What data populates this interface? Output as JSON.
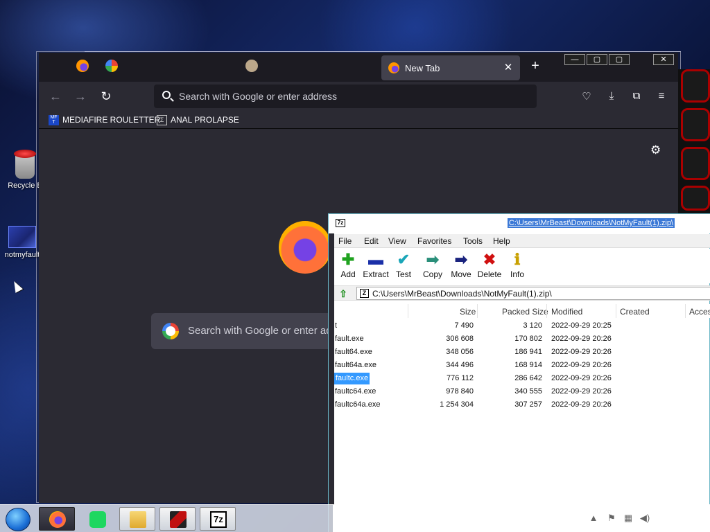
{
  "desktop": {
    "icons": [
      {
        "label": "Recycle B"
      },
      {
        "label": "notmyfault"
      }
    ]
  },
  "firefox": {
    "tabs": [
      {
        "label": "New Tab",
        "active": true
      }
    ],
    "new_tab_symbol": "+",
    "nav": {
      "back": "←",
      "forward": "→",
      "reload": "↻"
    },
    "urlbar": {
      "placeholder": "Search with Google or enter address"
    },
    "toolbar_icons": [
      "pocket-icon",
      "download-icon",
      "extensions-icon",
      "menu-icon"
    ],
    "bookmarks": [
      {
        "label": "MEDIAFIRE ROULETTER",
        "icon": "mediafire-icon"
      },
      {
        "label": "ANAL PROLAPSE",
        "icon": "bookmark-icon"
      }
    ],
    "content": {
      "search_placeholder": "Search with Google or enter address"
    },
    "window_controls": [
      "—",
      "▢",
      "✕"
    ]
  },
  "sevenzip": {
    "title": "C:\\Users\\MrBeast\\Downloads\\NotMyFault(1).zip\\",
    "app_icon": "7z",
    "menu": [
      "File",
      "Edit",
      "View",
      "Favorites",
      "Tools",
      "Help"
    ],
    "toolbar": [
      {
        "label": "Add",
        "icon": "add-icon",
        "color": "#1fa21f"
      },
      {
        "label": "Extract",
        "icon": "extract-icon",
        "color": "#1a2fa8"
      },
      {
        "label": "Test",
        "icon": "test-icon",
        "color": "#1aa6b8"
      },
      {
        "label": "Copy",
        "icon": "copy-icon",
        "color": "#2a8f7a"
      },
      {
        "label": "Move",
        "icon": "move-icon",
        "color": "#1a237e"
      },
      {
        "label": "Delete",
        "icon": "delete-icon",
        "color": "#d01010"
      },
      {
        "label": "Info",
        "icon": "info-icon",
        "color": "#c8a000"
      }
    ],
    "path": "C:\\Users\\MrBeast\\Downloads\\NotMyFault(1).zip\\",
    "columns": [
      "Size",
      "Packed Size",
      "Modified",
      "Created",
      "Acces"
    ],
    "rows": [
      {
        "name": "t",
        "size": "7 490",
        "packed": "3 120",
        "modified": "2022-09-29 20:25"
      },
      {
        "name": "fault.exe",
        "size": "306 608",
        "packed": "170 802",
        "modified": "2022-09-29 20:26"
      },
      {
        "name": "fault64.exe",
        "size": "348 056",
        "packed": "186 941",
        "modified": "2022-09-29 20:26"
      },
      {
        "name": "fault64a.exe",
        "size": "344 496",
        "packed": "168 914",
        "modified": "2022-09-29 20:26"
      },
      {
        "name": "faultc.exe",
        "size": "776 112",
        "packed": "286 642",
        "modified": "2022-09-29 20:26",
        "selected": true
      },
      {
        "name": "faultc64.exe",
        "size": "978 840",
        "packed": "340 555",
        "modified": "2022-09-29 20:26"
      },
      {
        "name": "faultc64a.exe",
        "size": "1 254 304",
        "packed": "307 257",
        "modified": "2022-09-29 20:26"
      }
    ]
  },
  "taskbar": {
    "apps": [
      "firefox-icon",
      "spotify-icon",
      "file-explorer-icon",
      "media-app-icon",
      "7zip-icon"
    ],
    "app_7z_label": "7z",
    "tray": [
      "tray-arrow-icon",
      "tray-flag-icon",
      "tray-network-icon",
      "tray-volume-icon"
    ]
  }
}
